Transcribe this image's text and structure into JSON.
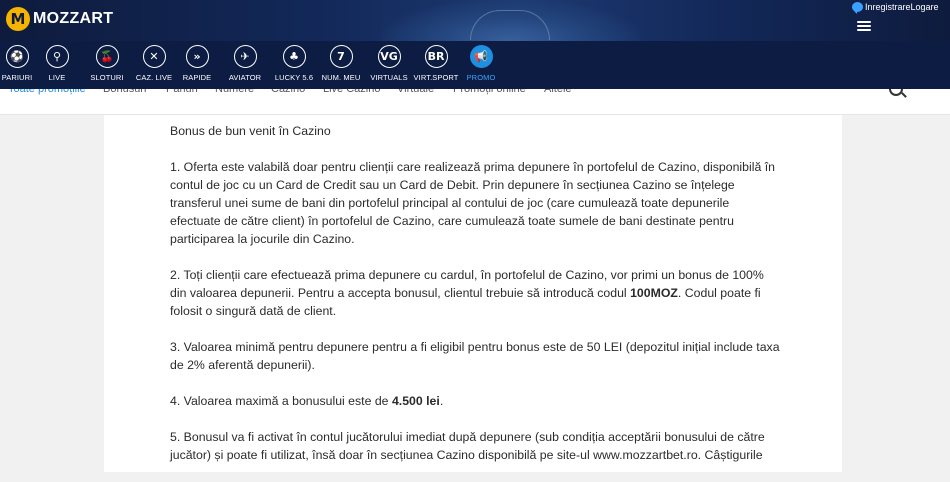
{
  "header": {
    "logo_badge": "M",
    "logo_text": "MOZZART",
    "register_label": "Inregistrare",
    "login_label": "Logare",
    "menu_icon": "hamburger-icon",
    "chat_icon": "chat-icon"
  },
  "categories": [
    {
      "label": "PARIURI",
      "glyph": "⚽",
      "icon": "soccer-ball-icon",
      "active": false
    },
    {
      "label": "LIVE",
      "glyph": "⚲",
      "icon": "live-icon",
      "active": false
    },
    {
      "label": "SLOTURI",
      "glyph": "🍒",
      "icon": "cherries-icon",
      "active": false
    },
    {
      "label": "CAZ. LIVE",
      "glyph": "✕",
      "icon": "casino-chip-icon",
      "active": false
    },
    {
      "label": "RAPIDE",
      "glyph": "»",
      "icon": "rapid-icon",
      "active": false
    },
    {
      "label": "AVIATOR",
      "glyph": "✈",
      "icon": "airplane-icon",
      "active": false
    },
    {
      "label": "LUCKY 5.6",
      "glyph": "♣",
      "icon": "clover-icon",
      "active": false
    },
    {
      "label": "NUM. MEU",
      "glyph": "7",
      "icon": "number-seven-icon",
      "active": false
    },
    {
      "label": "VIRTUALS",
      "glyph": "VG",
      "icon": "virtual-games-icon",
      "active": false
    },
    {
      "label": "VIRT.SPORT",
      "glyph": "BR",
      "icon": "virtual-sport-icon",
      "active": false
    },
    {
      "label": "PROMO",
      "glyph": "📢",
      "icon": "megaphone-icon",
      "active": true
    }
  ],
  "subnav": {
    "tabs": [
      "Toate promoțiile",
      "Bonusuri",
      "Pariuri",
      "Numere",
      "Cazino",
      "Live Cazino",
      "Virtuale",
      "Promoții online",
      "Altele"
    ],
    "active_index": 0,
    "search_icon": "search-icon"
  },
  "content": {
    "title": "Bonus de bun venit în Cazino",
    "p1": "1. Oferta este valabilă doar pentru clienții care realizează prima depunere în portofelul de Cazino, disponibilă în contul de joc cu un Card de Credit sau un Card de Debit. Prin depunere în secțiunea Cazino se înțelege transferul unei sume de bani din portofelul principal al contului de joc (care cumulează toate depunerile efectuate de către client) în portofelul de Cazino, care cumulează toate sumele de bani destinate pentru participarea la jocurile din Cazino.",
    "p2_a": "2. Toți clienții care efectuează prima depunere cu cardul, în portofelul de Cazino, vor primi un bonus de 100% din valoarea depunerii. Pentru a accepta bonusul, clientul trebuie să introducă codul ",
    "p2_code": "100MOZ",
    "p2_b": ". Codul poate fi folosit o singură dată de client.",
    "p3": "3. Valoarea minimă pentru depunere pentru a fi eligibil pentru bonus este de 50 LEI (depozitul inițial include taxa de 2% aferentă depunerii).",
    "p4_a": "4. Valoarea maximă a bonusului este de ",
    "p4_amount": "4.500 lei",
    "p4_b": ".",
    "p5": "5. Bonusul va fi activat în contul jucătorului imediat după depunere (sub condiția acceptării bonusului de către jucător) și poate fi utilizat, însă doar în secțiunea Cazino disponibilă pe site-ul www.mozzartbet.ro. Câștigurile"
  },
  "colors": {
    "header_bg": "#0e1b3d",
    "nav_bg": "#0c1c43",
    "accent": "#1f8fe0",
    "logo_yellow": "#f6b400"
  }
}
